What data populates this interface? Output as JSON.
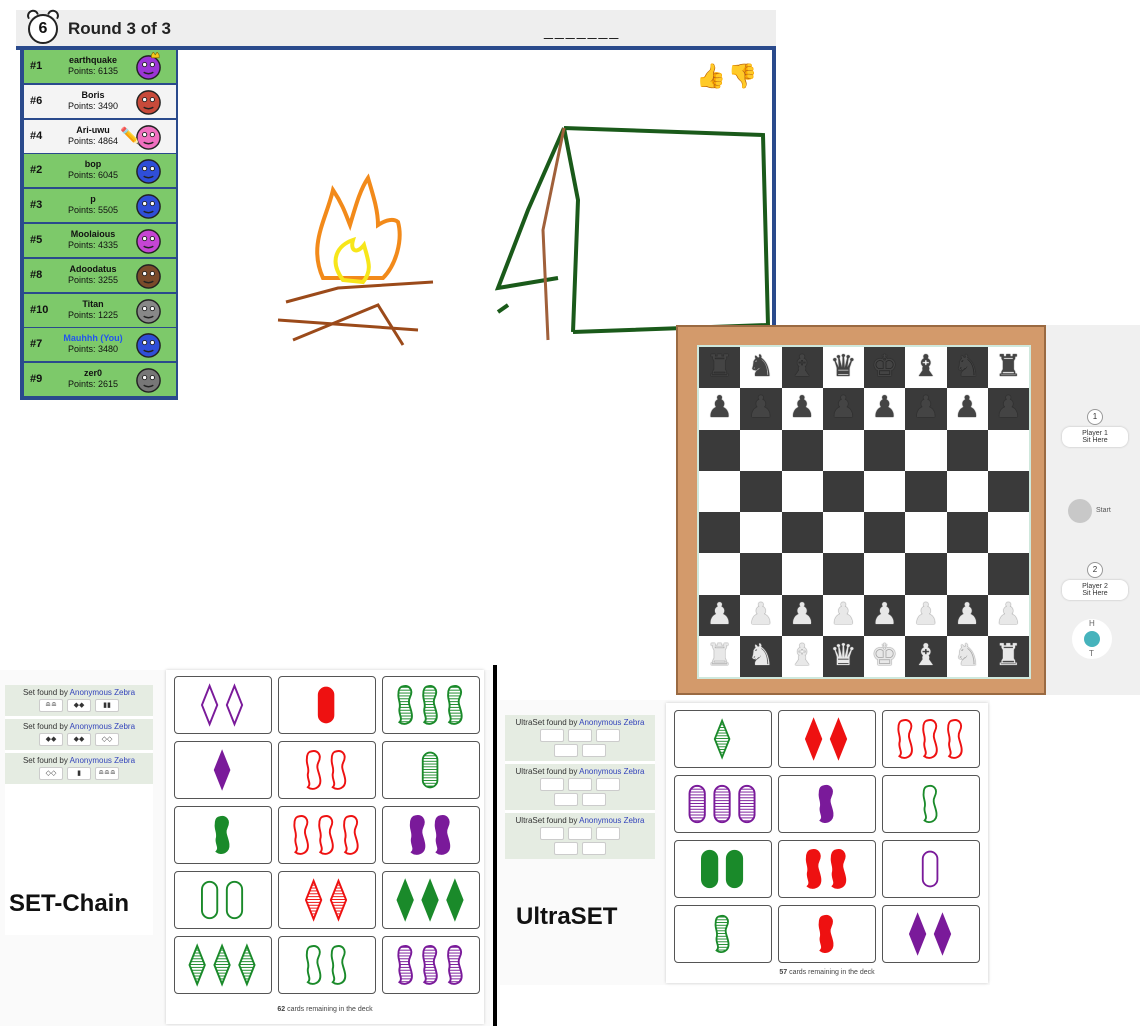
{
  "pictionary": {
    "timer": "6",
    "round_label": "Round 3 of 3",
    "word_hint": "_______",
    "players": [
      {
        "rank": "#1",
        "name": "earthquake",
        "points": "Points: 6135",
        "bg": "g",
        "avatar_color": "#9b35d6",
        "crown": true
      },
      {
        "rank": "#6",
        "name": "Boris",
        "points": "Points: 3490",
        "bg": "w",
        "avatar_color": "#c84a3a"
      },
      {
        "rank": "#4",
        "name": "Ari-uwu",
        "points": "Points: 4864",
        "bg": "w",
        "avatar_color": "#f06fc0",
        "drawing": true
      },
      {
        "rank": "#2",
        "name": "bop",
        "points": "Points: 6045",
        "bg": "g",
        "avatar_color": "#2f4ed8"
      },
      {
        "rank": "#3",
        "name": "p",
        "points": "Points: 5505",
        "bg": "g",
        "avatar_color": "#2f4ed8"
      },
      {
        "rank": "#5",
        "name": "Moolaious",
        "points": "Points: 4335",
        "bg": "g",
        "avatar_color": "#c545d4"
      },
      {
        "rank": "#8",
        "name": "Adoodatus",
        "points": "Points: 3255",
        "bg": "g",
        "avatar_color": "#7a4a2a"
      },
      {
        "rank": "#10",
        "name": "Titan",
        "points": "Points: 1225",
        "bg": "g",
        "avatar_color": "#888888"
      },
      {
        "rank": "#7",
        "name": "Mauhhh (You)",
        "points": "Points: 3480",
        "bg": "g",
        "avatar_color": "#2f4ed8",
        "you": true
      },
      {
        "rank": "#9",
        "name": "zer0",
        "points": "Points: 2615",
        "bg": "g",
        "avatar_color": "#777777"
      }
    ],
    "thumbs_up": "👍",
    "thumbs_down": "👎"
  },
  "chess": {
    "back_rank": [
      "♜",
      "♞",
      "♝",
      "♛",
      "♚",
      "♝",
      "♞",
      "♜"
    ],
    "pawn": "♟",
    "player1": {
      "number": "1",
      "label": "Player 1",
      "action": "Sit Here"
    },
    "player2": {
      "number": "2",
      "label": "Player 2",
      "action": "Sit Here"
    },
    "start_label": "Start",
    "coin_heads": "H",
    "coin_tails": "T"
  },
  "set_chain": {
    "title": "SET-Chain",
    "log": [
      {
        "prefix": "Set found by",
        "who": "Anonymous Zebra",
        "minis": [
          "≘≘",
          "◆◆",
          "▮▮"
        ]
      },
      {
        "prefix": "Set found by",
        "who": "Anonymous Zebra",
        "minis": [
          "◆◆",
          "◆◆",
          "◇◇"
        ]
      },
      {
        "prefix": "Set found by",
        "who": "Anonymous Zebra",
        "minis": [
          "◇◇",
          "▮",
          "≘≘≘"
        ]
      }
    ],
    "remaining_count": "62",
    "remaining_text": "cards remaining in the deck",
    "cards": [
      {
        "n": 2,
        "shape": "diamond",
        "color": "#7a1a9a",
        "fill": "empty"
      },
      {
        "n": 1,
        "shape": "oval",
        "color": "#ee1111",
        "fill": "solid"
      },
      {
        "n": 3,
        "shape": "squiggle",
        "color": "#1a8a2a",
        "fill": "striped"
      },
      {
        "n": 1,
        "shape": "diamond",
        "color": "#7a1a9a",
        "fill": "solid"
      },
      {
        "n": 2,
        "shape": "squiggle",
        "color": "#ee1111",
        "fill": "empty"
      },
      {
        "n": 1,
        "shape": "oval",
        "color": "#1a8a2a",
        "fill": "striped"
      },
      {
        "n": 1,
        "shape": "squiggle",
        "color": "#1a8a2a",
        "fill": "solid"
      },
      {
        "n": 3,
        "shape": "squiggle",
        "color": "#ee1111",
        "fill": "empty"
      },
      {
        "n": 2,
        "shape": "squiggle",
        "color": "#7a1a9a",
        "fill": "solid"
      },
      {
        "n": 2,
        "shape": "oval",
        "color": "#1a8a2a",
        "fill": "empty"
      },
      {
        "n": 2,
        "shape": "diamond",
        "color": "#ee1111",
        "fill": "striped"
      },
      {
        "n": 3,
        "shape": "diamond",
        "color": "#1a8a2a",
        "fill": "solid"
      },
      {
        "n": 3,
        "shape": "diamond",
        "color": "#1a8a2a",
        "fill": "striped"
      },
      {
        "n": 2,
        "shape": "squiggle",
        "color": "#1a8a2a",
        "fill": "empty"
      },
      {
        "n": 3,
        "shape": "squiggle",
        "color": "#7a1a9a",
        "fill": "striped"
      }
    ]
  },
  "ultraset": {
    "title": "UltraSET",
    "log": [
      {
        "prefix": "UltraSet found by",
        "who": "Anonymous Zebra"
      },
      {
        "prefix": "UltraSet found by",
        "who": "Anonymous Zebra"
      },
      {
        "prefix": "UltraSet found by",
        "who": "Anonymous Zebra"
      }
    ],
    "remaining_count": "57",
    "remaining_text": "cards remaining in the deck",
    "cards": [
      {
        "n": 1,
        "shape": "diamond",
        "color": "#1a8a2a",
        "fill": "striped"
      },
      {
        "n": 2,
        "shape": "diamond",
        "color": "#ee1111",
        "fill": "solid"
      },
      {
        "n": 3,
        "shape": "squiggle",
        "color": "#ee1111",
        "fill": "empty"
      },
      {
        "n": 3,
        "shape": "oval",
        "color": "#7a1a9a",
        "fill": "striped"
      },
      {
        "n": 1,
        "shape": "squiggle",
        "color": "#7a1a9a",
        "fill": "solid"
      },
      {
        "n": 1,
        "shape": "squiggle",
        "color": "#1a8a2a",
        "fill": "empty"
      },
      {
        "n": 2,
        "shape": "oval",
        "color": "#1a8a2a",
        "fill": "solid"
      },
      {
        "n": 2,
        "shape": "squiggle",
        "color": "#ee1111",
        "fill": "solid"
      },
      {
        "n": 1,
        "shape": "oval",
        "color": "#7a1a9a",
        "fill": "empty"
      },
      {
        "n": 1,
        "shape": "squiggle",
        "color": "#1a8a2a",
        "fill": "striped"
      },
      {
        "n": 1,
        "shape": "squiggle",
        "color": "#ee1111",
        "fill": "solid"
      },
      {
        "n": 2,
        "shape": "diamond",
        "color": "#7a1a9a",
        "fill": "solid"
      }
    ]
  }
}
